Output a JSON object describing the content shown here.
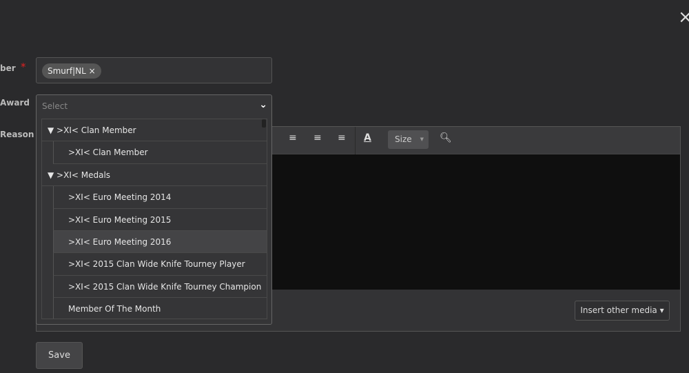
{
  "form": {
    "member_label": "ber",
    "award_label": "Award",
    "reason_label": "Reason",
    "required_mark": "*"
  },
  "member": {
    "tag": "Smurf|NL",
    "tag_remove": "×"
  },
  "award": {
    "placeholder": "Select",
    "groups": [
      {
        "label": ">XI< Clan Member",
        "items": [
          {
            "label": ">XI< Clan Member"
          }
        ]
      },
      {
        "label": ">XI< Medals",
        "items": [
          {
            "label": ">XI< Euro Meeting 2014"
          },
          {
            "label": ">XI< Euro Meeting 2015"
          },
          {
            "label": ">XI< Euro Meeting 2016",
            "highlighted": true
          },
          {
            "label": ">XI< 2015 Clan Wide Knife Tourney Player"
          },
          {
            "label": ">XI< 2015 Clan Wide Knife Tourney Champion"
          },
          {
            "label": "Member Of The Month"
          }
        ]
      }
    ]
  },
  "editor": {
    "size_label": "Size",
    "insert_media": "Insert other media ▾"
  },
  "save_label": "Save",
  "close_icon": "×"
}
